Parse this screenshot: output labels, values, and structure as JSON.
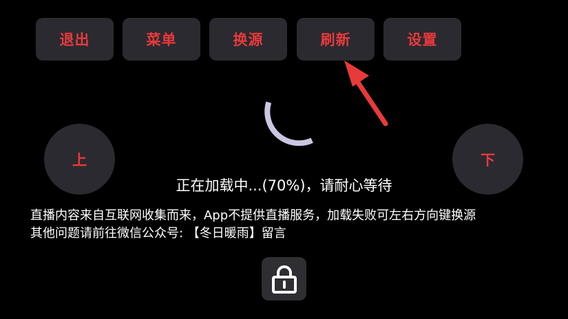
{
  "toolbar": {
    "exit_label": "退出",
    "menu_label": "菜单",
    "switch_source_label": "换源",
    "refresh_label": "刷新",
    "settings_label": "设置"
  },
  "nav": {
    "up_label": "上",
    "down_label": "下"
  },
  "loading": {
    "progress": 70,
    "message": "正在加载中...(70%)，请耐心等待"
  },
  "notice": {
    "line1": "直播内容来自互联网收集而来，App不提供直播服务，加载失败可左右方向键换源",
    "line2": "其他问题请前往微信公众号: 【冬日暖雨】留言"
  },
  "icons": {
    "lock": "lock-icon",
    "spinner": "loading-spinner-icon",
    "pointer": "red-arrow-icon"
  },
  "colors": {
    "accent": "#e8393b",
    "button_bg": "#2b2a30",
    "spinner": "#cdc6e0",
    "background": "#000000"
  }
}
